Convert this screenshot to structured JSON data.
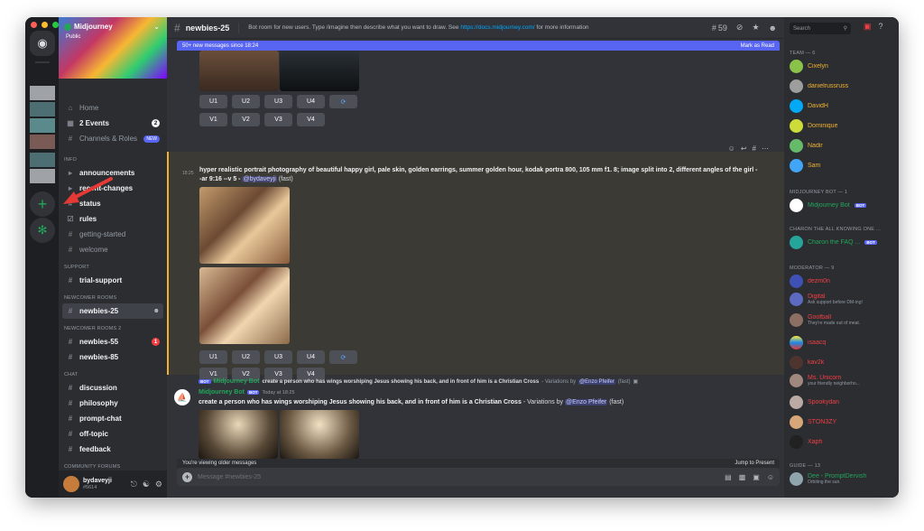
{
  "colors": {
    "accent": "#5865f2",
    "green": "#23a55a",
    "mod": "#f23f43",
    "team": "#f0b232"
  },
  "server": {
    "name": "Midjourney",
    "public": "Public"
  },
  "channels": {
    "home": "Home",
    "events": "2 Events",
    "events_count": "2",
    "channels_roles": "Channels & Roles",
    "new_badge": "NEW",
    "cat_info": "INFO",
    "announcements": "announcements",
    "recent_changes": "recent-changes",
    "status": "status",
    "rules": "rules",
    "getting_started": "getting-started",
    "welcome": "welcome",
    "cat_support": "SUPPORT",
    "trial_support": "trial-support",
    "cat_newcomer": "NEWCOMER ROOMS",
    "newbies25": "newbies-25",
    "cat_newcomer2": "NEWCOMER ROOMS 2",
    "newbies55": "newbies-55",
    "newbies55_count": "1",
    "newbies85": "newbies-85",
    "cat_chat": "CHAT",
    "discussion": "discussion",
    "philosophy": "philosophy",
    "prompt_chat": "prompt-chat",
    "off_topic": "off-topic",
    "feedback": "feedback",
    "cat_forums": "COMMUNITY FORUMS"
  },
  "user": {
    "name": "bydaveyji",
    "tag": "#5614"
  },
  "header": {
    "channel": "newbies-25",
    "topic": "Bot room for new users. Type /imagine then describe what you want to draw. See",
    "link": "https://docs.midjourney.com/",
    "topic_end": "for more information",
    "threads_count": "59"
  },
  "new_messages": {
    "text": "50+ new messages since 18:24",
    "mark": "Mark as Read"
  },
  "buttons": {
    "u1": "U1",
    "u2": "U2",
    "u3": "U3",
    "u4": "U4",
    "v1": "V1",
    "v2": "V2",
    "v3": "V3",
    "v4": "V4"
  },
  "message1": {
    "time": "18:25",
    "prompt": "hyper realistic portrait photography of beautiful happy girl, pale skin, golden earrings, summer golden hour, kodak portra 800, 105 mm f1. 8; image split into 2, different angles of the girl --ar 9:16 --v 5 -",
    "mention": "@bydaveyji",
    "fast": "(fast)"
  },
  "message2": {
    "reply_prompt": "create a person who has wings worshiping Jesus showing his back, and in front of him is a Christian Cross",
    "reply_suffix": "- Variations by",
    "mention": "@Enzo Pfeifer",
    "fast": "(fast)",
    "author": "Midjourney Bot",
    "bot_tag": "BOT",
    "time": "Today at 18:25"
  },
  "composer": {
    "older": "You're viewing older messages",
    "jump": "Jump to Present",
    "placeholder": "Message #newbies-25"
  },
  "members": {
    "search": "Search",
    "team_header": "TEAM — 6",
    "team": [
      "Cixelyn",
      "danielrussruss",
      "DavidH",
      "Dominique",
      "Nadir",
      "Sam"
    ],
    "bot_header": "MIDJOURNEY BOT — 1",
    "bot": "Midjourney Bot",
    "charon_header": "CHARON THE ALL KNOWING ONE ...",
    "charon": "Charon the FAQ ...",
    "mod_header": "MODERATOR — 9",
    "mods": [
      {
        "name": "dezm0n",
        "sub": ""
      },
      {
        "name": "Digital",
        "sub": "Ask support before DM-ing!"
      },
      {
        "name": "Goofball",
        "sub": "They're made out of meat."
      },
      {
        "name": "isaacq",
        "sub": ""
      },
      {
        "name": "kav2k",
        "sub": ""
      },
      {
        "name": "Ms. Unicorn",
        "sub": "your friendly neighborho..."
      },
      {
        "name": "Spookydan",
        "sub": ""
      },
      {
        "name": "STON3ZY",
        "sub": ""
      },
      {
        "name": "Xaph",
        "sub": ""
      }
    ],
    "guide_header": "GUIDE — 13",
    "guide": {
      "name": "Dee - PromptDervish",
      "sub": "Orbiting the sun."
    }
  }
}
